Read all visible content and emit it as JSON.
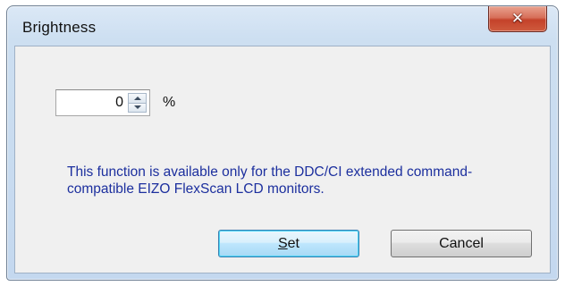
{
  "window": {
    "title": "Brightness",
    "close_icon": "close-icon"
  },
  "brightness": {
    "value": "0",
    "unit": "%"
  },
  "info": {
    "message": "This function is available only for the DDC/CI extended command-compatible EIZO FlexScan LCD monitors."
  },
  "buttons": {
    "set_mnemonic": "S",
    "set_rest": "et",
    "cancel_label": "Cancel"
  },
  "colors": {
    "info_text": "#1c2f9e",
    "close_button": "#c4422a",
    "default_button_border": "#3c7fb1"
  }
}
